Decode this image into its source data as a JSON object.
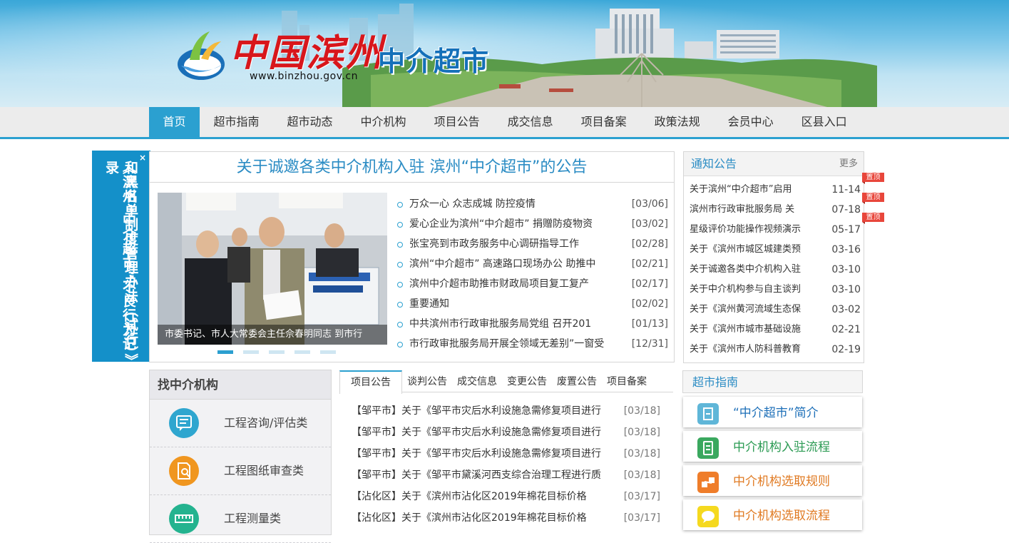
{
  "site": {
    "logo_text": "中国滨州",
    "logo_subtitle": "中介超市",
    "logo_url": "www.binzhou.gov.cn"
  },
  "nav": [
    "首页",
    "超市指南",
    "超市动态",
    "中介机构",
    "项目公告",
    "成交信息",
    "项目备案",
    "政策法规",
    "会员中心",
    "区县入口"
  ],
  "side_ad": {
    "col1": "和黑名单制度管理办法（试行）》",
    "col2": "《滨州“中介超市”不良行为记录",
    "close": "×"
  },
  "headline": {
    "title": "关于诚邀各类中介机构入驻 滨州“中介超市”的公告",
    "photo_caption": "市委书记、市人大常委会主任佘春明同志 到市行",
    "news": [
      {
        "title": "万众一心 众志成城 防控疫情",
        "date": "[03/06]"
      },
      {
        "title": "爱心企业为滨州“中介超市” 捐赠防疫物资",
        "date": "[03/02]"
      },
      {
        "title": "张宝亮到市政务服务中心调研指导工作",
        "date": "[02/28]"
      },
      {
        "title": "滨州“中介超市” 高速路口现场办公 助推中",
        "date": "[02/21]"
      },
      {
        "title": "滨州中介超市助推市财政局项目复工复产",
        "date": "[02/17]"
      },
      {
        "title": "重要通知",
        "date": "[02/02]"
      },
      {
        "title": "中共滨州市行政审批服务局党组 召开201",
        "date": "[01/13]"
      },
      {
        "title": "市行政审批服务局开展全领域无差别”一窗受",
        "date": "[12/31]"
      }
    ]
  },
  "notice": {
    "title": "通知公告",
    "more": "更多",
    "pin_label": "置顶",
    "items": [
      {
        "title": "关于滨州“中介超市”启用",
        "date": "11-14"
      },
      {
        "title": "滨州市行政审批服务局 关",
        "date": "07-18"
      },
      {
        "title": "星级评价功能操作视频演示",
        "date": "05-17"
      },
      {
        "title": "关于《滨州市城区城建类预",
        "date": "03-16"
      },
      {
        "title": "关于诚邀各类中介机构入驻",
        "date": "03-10"
      },
      {
        "title": "关于中介机构参与自主谈判",
        "date": "03-10"
      },
      {
        "title": "关于《滨州黄河流域生态保",
        "date": "03-02"
      },
      {
        "title": "关于《滨州市城市基础设施",
        "date": "02-21"
      },
      {
        "title": "关于《滨州市人防科普教育",
        "date": "02-19"
      }
    ]
  },
  "find": {
    "title": "找中介机构",
    "items": [
      {
        "label": "工程咨询/评估类",
        "icon": "consult-icon",
        "color": "#2fa6cf"
      },
      {
        "label": "工程图纸审查类",
        "icon": "drawing-review-icon",
        "color": "#f0961f"
      },
      {
        "label": "工程测量类",
        "icon": "ruler-icon",
        "color": "#24b38f"
      }
    ]
  },
  "tabs": {
    "labels": [
      "项目公告",
      "谈判公告",
      "成交信息",
      "变更公告",
      "废置公告",
      "项目备案"
    ],
    "items": [
      {
        "title": "【邹平市】关于《邹平市灾后水利设施急需修复项目进行",
        "date": "[03/18]"
      },
      {
        "title": "【邹平市】关于《邹平市灾后水利设施急需修复项目进行",
        "date": "[03/18]"
      },
      {
        "title": "【邹平市】关于《邹平市灾后水利设施急需修复项目进行",
        "date": "[03/18]"
      },
      {
        "title": "【邹平市】关于《邹平市黛溪河西支综合治理工程进行质",
        "date": "[03/18]"
      },
      {
        "title": "【沾化区】关于《滨州市沾化区2019年棉花目标价格",
        "date": "[03/17]"
      },
      {
        "title": "【沾化区】关于《滨州市沾化区2019年棉花目标价格",
        "date": "[03/17]"
      }
    ]
  },
  "guide": {
    "title": "超市指南",
    "items": [
      {
        "label": "“中介超市”简介",
        "icon": "intro-icon",
        "color": "#1d6fb8",
        "icon_color": "#5fb6d8"
      },
      {
        "label": "中介机构入驻流程",
        "icon": "document-icon",
        "color": "#2a9a52",
        "icon_color": "#3aa85f"
      },
      {
        "label": "中介机构选取规则",
        "icon": "rules-icon",
        "color": "#e07a22",
        "icon_color": "#ef7d2a"
      },
      {
        "label": "中介机构选取流程",
        "icon": "chat-icon",
        "color": "#e07a22",
        "icon_color": "#f5d91f"
      }
    ]
  }
}
